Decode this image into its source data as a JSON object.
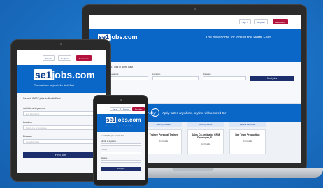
{
  "nav": {
    "sign_in": "Sign in",
    "register": "Register",
    "recruiters": "Recruiters"
  },
  "logo": {
    "prefix": "se1",
    "suffix": "jobs.com"
  },
  "tagline": "The new home for jobs in the North East",
  "search": {
    "heading": "Search 8,697 jobs in North East",
    "job_title_label": "Job title or keywords",
    "job_title_placeholder": "e.g. Developer",
    "location_label": "Location",
    "location_placeholder": "Town, city or postcode",
    "distance_label": "Distance",
    "distance_value": "Up to 10 miles",
    "find_button": "Find jobs"
  },
  "promo": {
    "left": "Find jobs on the go with se1 Quick Apply",
    "right": "Apply faster, anywhere, anytime with a stored CV"
  },
  "cards": [
    {
      "tab": "Jobs by location",
      "title": "Trainee Personal Trainer",
      "detail": "Job Details"
    },
    {
      "tab": "Jobs by sector",
      "title": "Sales Co-ordinator CRM Developer, S...",
      "detail": "Job Details"
    },
    {
      "tab": "Recent searches",
      "title": "Bar Team Production",
      "detail": "Job Details"
    }
  ],
  "colors": {
    "brand_blue": "#0b67c7",
    "nav_red": "#b3123d",
    "button_navy": "#1c2e6b"
  }
}
